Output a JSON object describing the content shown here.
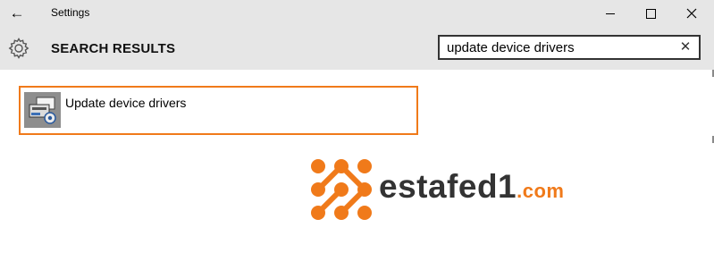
{
  "window": {
    "title": "Settings",
    "back_icon": "arrow-left-icon",
    "minimize_icon": "minimize-icon",
    "maximize_icon": "maximize-icon",
    "close_icon": "close-icon"
  },
  "header": {
    "icon": "gear-icon",
    "title": "SEARCH RESULTS"
  },
  "search": {
    "value": "update device drivers",
    "clear_icon": "clear-x-icon"
  },
  "results": [
    {
      "label": "Update device drivers",
      "icon": "device-manager-icon"
    }
  ],
  "watermark": {
    "text": "estafed1",
    "suffix": ".com",
    "colors": {
      "accent": "#f07a1a",
      "text": "#333333"
    }
  },
  "colors": {
    "chrome": "#e6e6e6",
    "highlight_border": "#f07a1a",
    "background": "#ffffff"
  }
}
